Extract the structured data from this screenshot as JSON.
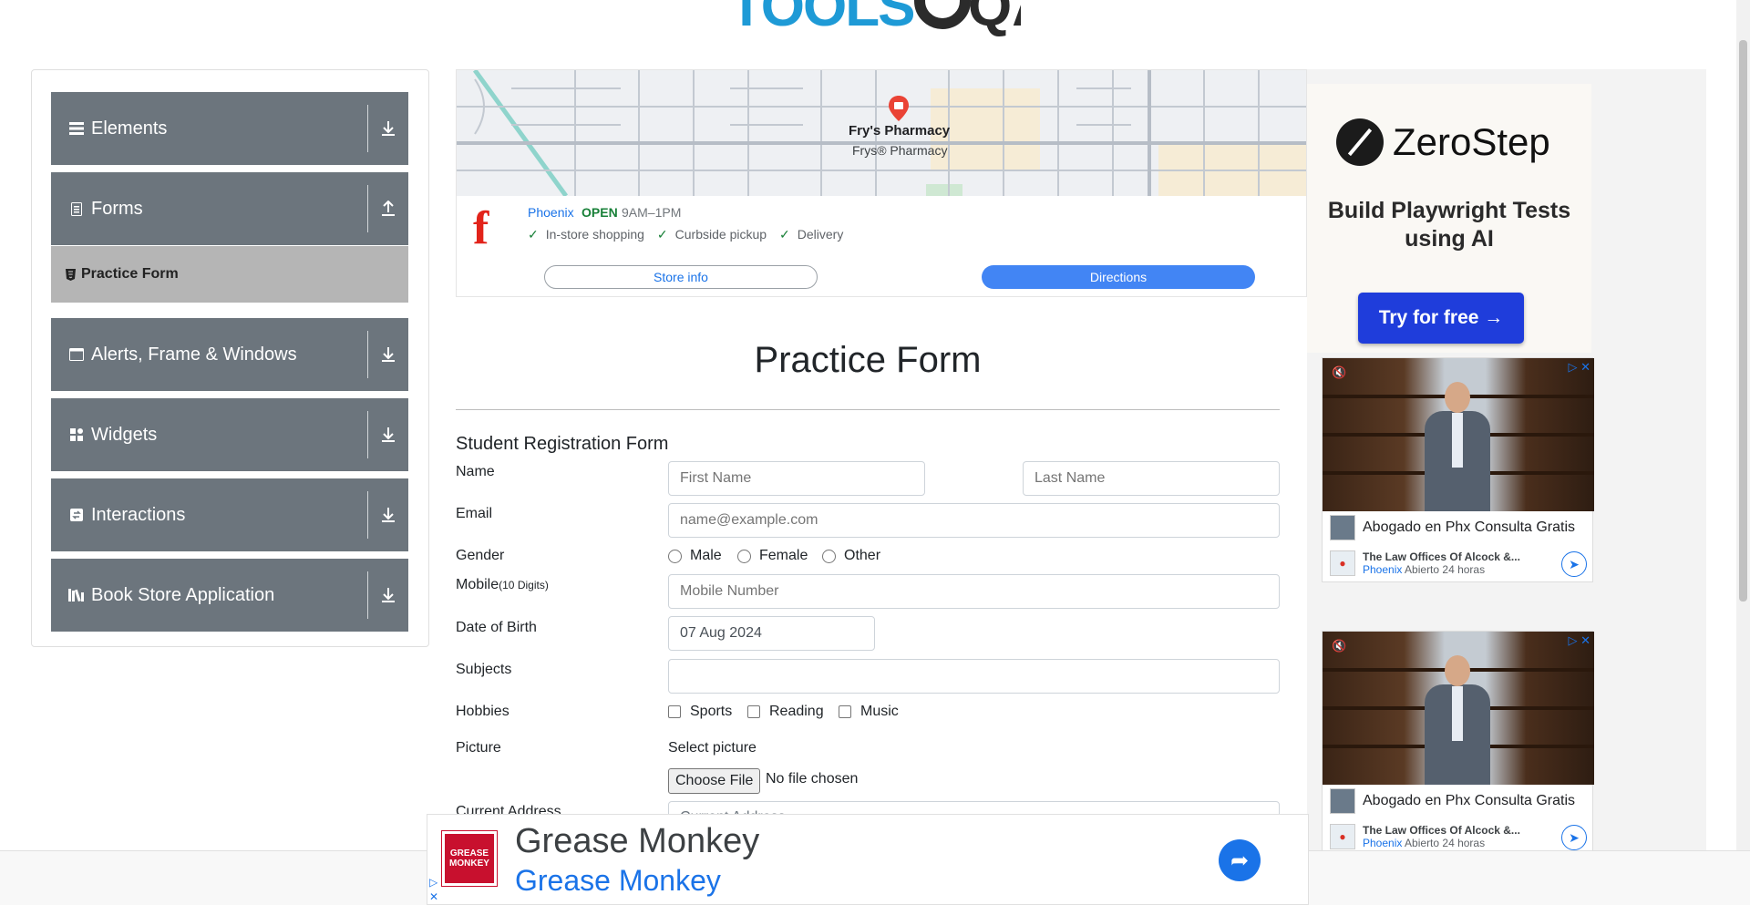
{
  "header": {
    "logo_text": "TOOLSQA"
  },
  "sidebar": {
    "groups": [
      {
        "label": "Elements",
        "icon": "list-icon",
        "arrow": "download-arrow-icon"
      },
      {
        "label": "Forms",
        "icon": "document-icon",
        "arrow": "upload-arrow-icon"
      },
      {
        "label": "Alerts, Frame & Windows",
        "icon": "window-icon",
        "arrow": "download-arrow-icon"
      },
      {
        "label": "Widgets",
        "icon": "grid-icon",
        "arrow": "download-arrow-icon"
      },
      {
        "label": "Interactions",
        "icon": "interaction-icon",
        "arrow": "download-arrow-icon"
      },
      {
        "label": "Book Store Application",
        "icon": "books-icon",
        "arrow": "download-arrow-icon"
      }
    ],
    "active_item": {
      "label": "Practice Form",
      "icon": "html5-icon"
    }
  },
  "map_ad": {
    "place_name": "Fry's Pharmacy",
    "place_sub": "Frys® Pharmacy",
    "city": "Phoenix",
    "status": "OPEN",
    "hours": "9AM–1PM",
    "features": [
      "In-store shopping",
      "Curbside pickup",
      "Delivery"
    ],
    "store_info_label": "Store info",
    "directions_label": "Directions",
    "brand_color": "#e2231a",
    "accent_color": "#4285f4"
  },
  "form": {
    "page_title": "Practice Form",
    "subtitle": "Student Registration Form",
    "name_label": "Name",
    "first_name_placeholder": "First Name",
    "last_name_placeholder": "Last Name",
    "email_label": "Email",
    "email_placeholder": "name@example.com",
    "gender_label": "Gender",
    "gender_options": [
      "Male",
      "Female",
      "Other"
    ],
    "mobile_label": "Mobile",
    "mobile_hint": "(10 Digits)",
    "mobile_placeholder": "Mobile Number",
    "dob_label": "Date of Birth",
    "dob_value": "07 Aug 2024",
    "subjects_label": "Subjects",
    "hobbies_label": "Hobbies",
    "hobby_options": [
      "Sports",
      "Reading",
      "Music"
    ],
    "picture_label": "Picture",
    "select_picture": "Select picture",
    "choose_file": "Choose File",
    "no_file": "No file chosen",
    "address_label": "Current Address",
    "address_placeholder": "Current Address"
  },
  "right_ads": {
    "zerostep": {
      "brand": "ZeroStep",
      "headline": "Build Playwright Tests using AI",
      "cta": "Try for free →",
      "cta_color": "#1f3ddb"
    },
    "video_ads": [
      {
        "title": "Abogado en Phx Consulta Gratis",
        "firm": "The Law Offices Of Alcock &...",
        "city": "Phoenix",
        "status": "Abierto 24 horas"
      },
      {
        "title": "Abogado en Phx Consulta Gratis",
        "firm": "The Law Offices Of Alcock &...",
        "city": "Phoenix",
        "status": "Abierto 24 horas"
      }
    ]
  },
  "bottom_ad": {
    "logo_text": "GREASE MONKEY",
    "title": "Grease Monkey",
    "subtitle": "Grease Monkey",
    "brand_color": "#c8102e"
  }
}
